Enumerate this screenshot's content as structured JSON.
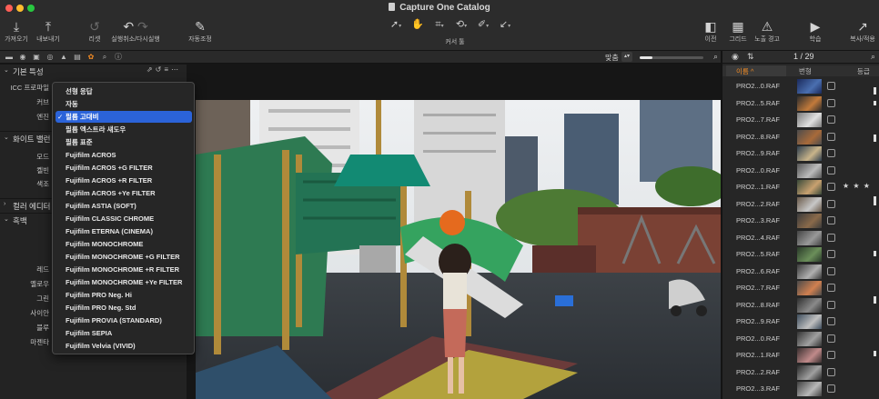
{
  "window": {
    "title": "Capture One Catalog"
  },
  "toolbar": {
    "import": "가져오기",
    "export": "내보내기",
    "reset": "리셋",
    "undo_redo": "실행취소/다시실행",
    "auto_adjust": "자동조정",
    "cursor_tools": "커서 툴",
    "before": "이전",
    "grid": "그리드",
    "exposure_warning": "노출 경고",
    "learn": "학습",
    "copy_apply": "복사/적용"
  },
  "left_panel": {
    "section_basic": "기본 특성",
    "icc_label": "ICC 프로파일",
    "curve_label": "커브",
    "engine_label": "엔진",
    "section_white_balance": "화이트 밸런",
    "mode_label": "모드",
    "kelvin_label": "켈빈",
    "tint_label": "색조",
    "section_color_editor": "컬러 에디터",
    "section_bw": "흑백",
    "red_label": "레드",
    "yellow_label": "옐로우",
    "green_label": "그린",
    "cyan_label": "사이안",
    "blue_label": "블루",
    "magenta_label": "마젠타"
  },
  "viewer": {
    "zoom_label": "맞춤",
    "zoom_level": 0.2
  },
  "browser": {
    "counter": "1 / 29",
    "col_name": "이름",
    "col_number": "번형",
    "col_rating": "등급",
    "rows": [
      {
        "name": "PRO2...0.RAF",
        "stars": ""
      },
      {
        "name": "PRO2...5.RAF",
        "stars": ""
      },
      {
        "name": "PRO2...7.RAF",
        "stars": ""
      },
      {
        "name": "PRO2...8.RAF",
        "stars": ""
      },
      {
        "name": "PRO2...9.RAF",
        "stars": ""
      },
      {
        "name": "PRO2...0.RAF",
        "stars": ""
      },
      {
        "name": "PRO2...1.RAF",
        "stars": "★ ★ ★"
      },
      {
        "name": "PRO2...2.RAF",
        "stars": ""
      },
      {
        "name": "PRO2...3.RAF",
        "stars": ""
      },
      {
        "name": "PRO2...4.RAF",
        "stars": ""
      },
      {
        "name": "PRO2...5.RAF",
        "stars": ""
      },
      {
        "name": "PRO2...6.RAF",
        "stars": ""
      },
      {
        "name": "PRO2...7.RAF",
        "stars": ""
      },
      {
        "name": "PRO2...8.RAF",
        "stars": ""
      },
      {
        "name": "PRO2...9.RAF",
        "stars": ""
      },
      {
        "name": "PRO2...0.RAF",
        "stars": ""
      },
      {
        "name": "PRO2...1.RAF",
        "stars": ""
      },
      {
        "name": "PRO2...2.RAF",
        "stars": ""
      },
      {
        "name": "PRO2...3.RAF",
        "stars": ""
      }
    ]
  },
  "curve_menu": {
    "selected_index": 2,
    "items": [
      "선형 응답",
      "자동",
      "필름 고대비",
      "필름 엑스트라 섀도우",
      "필름 표준",
      "Fujifilm ACROS",
      "Fujifilm ACROS +G FILTER",
      "Fujifilm ACROS +R FILTER",
      "Fujifilm ACROS +Ye FILTER",
      "Fujifilm ASTIA (SOFT)",
      "Fujifilm CLASSIC CHROME",
      "Fujifilm ETERNA (CINEMA)",
      "Fujifilm MONOCHROME",
      "Fujifilm MONOCHROME +G FILTER",
      "Fujifilm MONOCHROME +R FILTER",
      "Fujifilm MONOCHROME +Ye FILTER",
      "Fujifilm PRO Neg. Hi",
      "Fujifilm PRO Neg. Std",
      "Fujifilm PROVIA (STANDARD)",
      "Fujifilm SEPIA",
      "Fujifilm Velvia (VIVID)"
    ]
  }
}
